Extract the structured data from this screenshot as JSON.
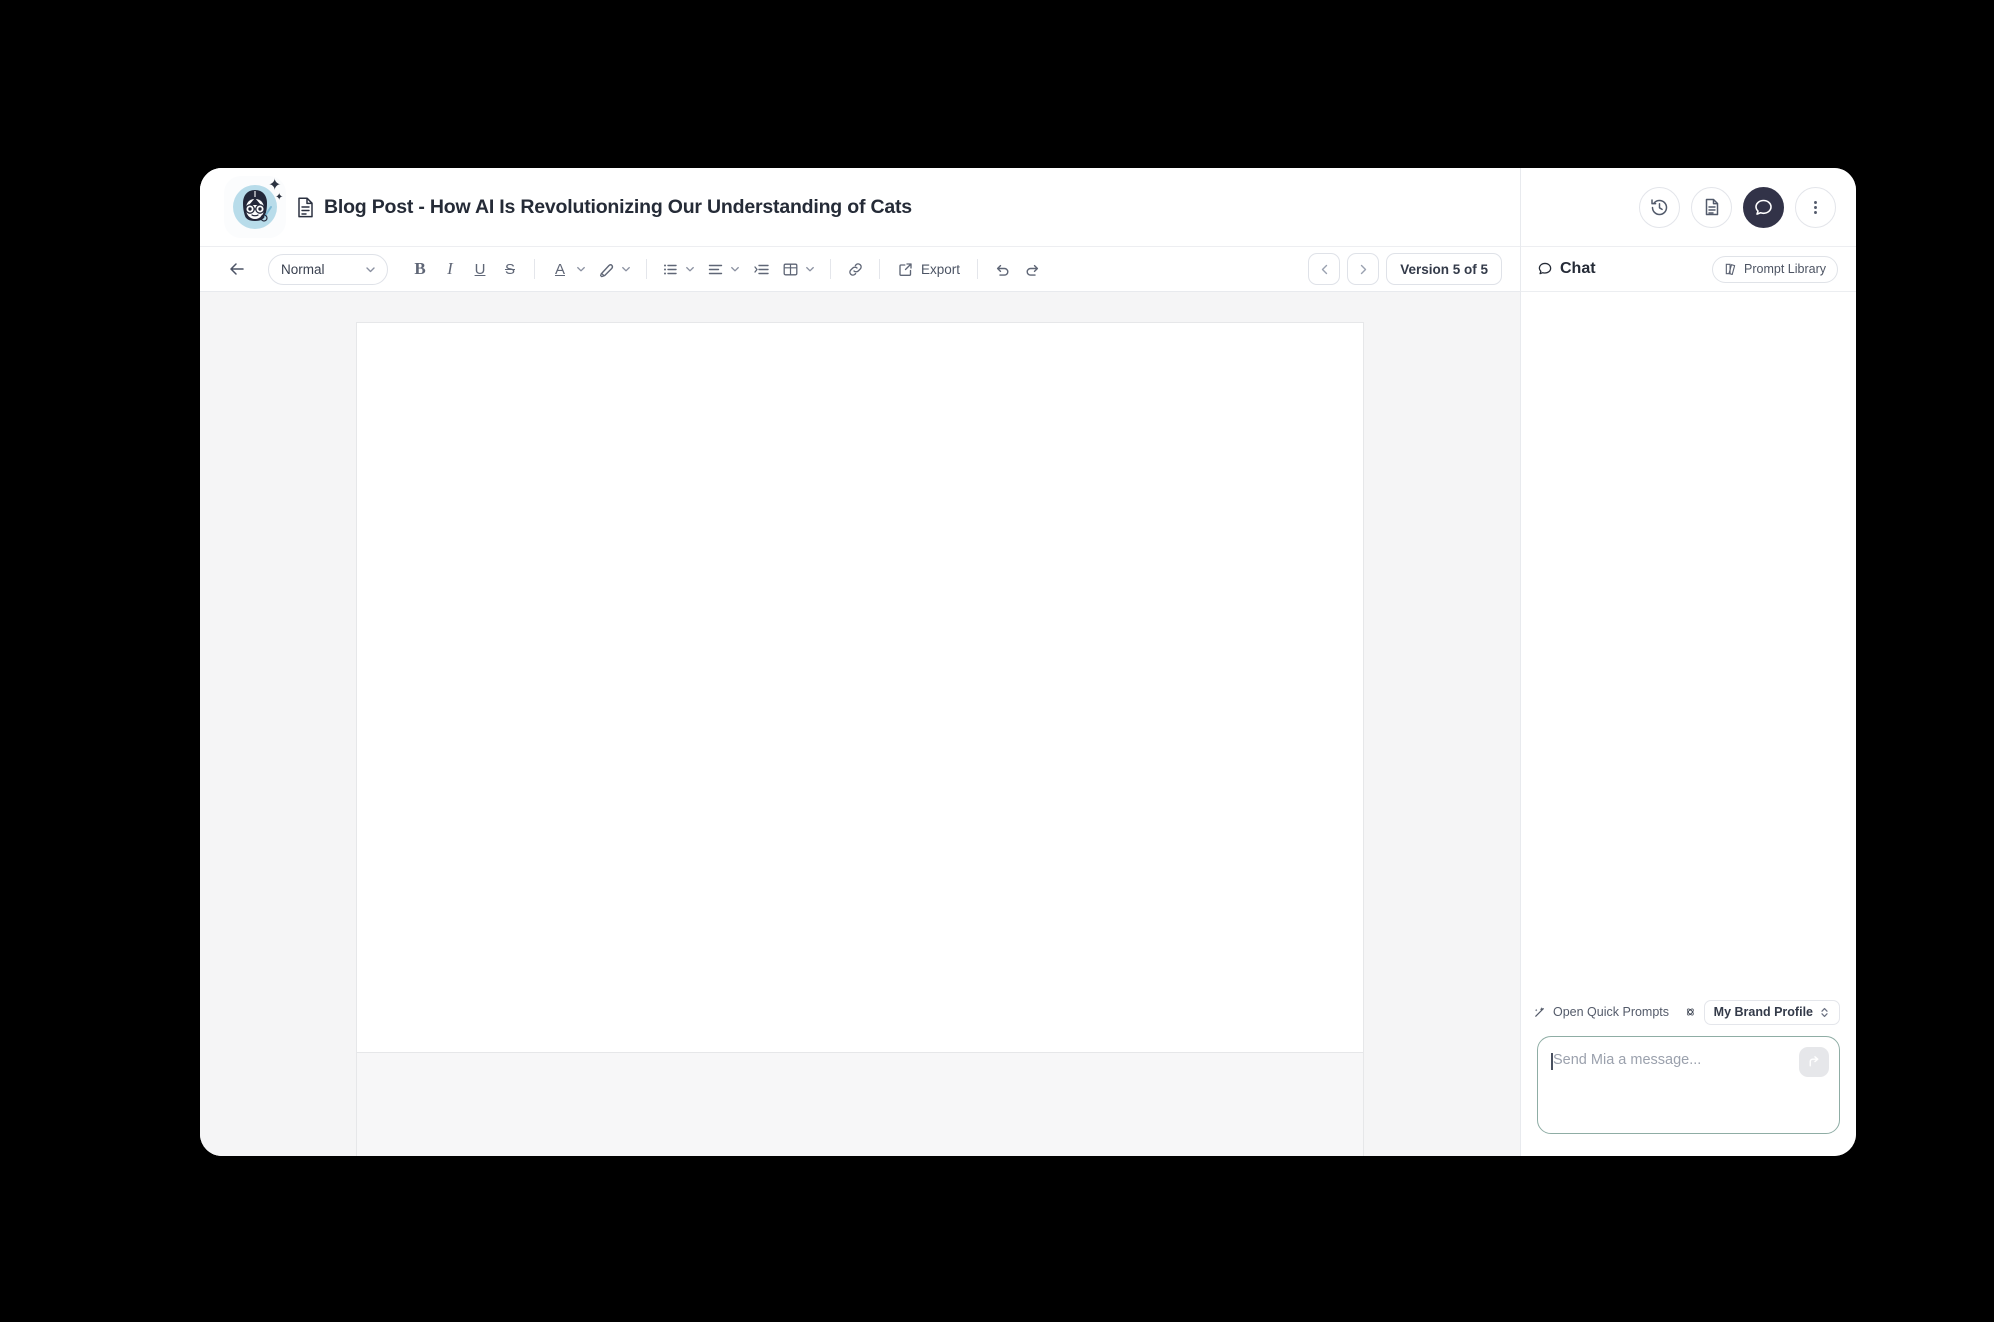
{
  "window": {
    "document": {
      "title": "Blog Post - How AI Is Revolutionizing Our Understanding of Cats",
      "file_icon": "document-icon",
      "avatar_icon": "mia-assistant-avatar"
    },
    "toolbar": {
      "back_icon": "arrow-left-icon",
      "paragraph_style": "Normal",
      "bold_label": "B",
      "italic_label": "I",
      "underline_label": "U",
      "strikethrough_label": "S",
      "text_color_label": "A",
      "highlight_icon": "highlighter-icon",
      "bullet_list_icon": "bullet-list-icon",
      "align_icon": "align-icon",
      "indent_icon": "indent-icon",
      "table_icon": "table-icon",
      "link_icon": "link-icon",
      "export_label": "Export",
      "export_icon": "external-link-icon",
      "undo_icon": "undo-icon",
      "redo_icon": "redo-icon",
      "prev_version_icon": "chevron-left-icon",
      "next_version_icon": "chevron-right-icon",
      "version_label": "Version 5 of 5"
    },
    "chat": {
      "header_buttons": [
        {
          "name": "history-button",
          "icon": "history-icon",
          "active": false
        },
        {
          "name": "document-button",
          "icon": "document-icon",
          "active": false
        },
        {
          "name": "chat-button",
          "icon": "chat-bubble-icon",
          "active": true
        },
        {
          "name": "more-options-button",
          "icon": "kebab-menu-icon",
          "active": false
        }
      ],
      "panel_title": "Chat",
      "panel_title_icon": "chat-bubble-icon",
      "prompt_library_label": "Prompt Library",
      "prompt_library_icon": "book-icon",
      "quick_prompts_label": "Open Quick Prompts",
      "quick_prompts_icon": "magic-wand-icon",
      "brand_profile_label": "My Brand Profile",
      "brand_profile_icon": "brand-icon",
      "brand_profile_chevron": "chevron-up-down-icon",
      "composer_placeholder": "Send Mia a message...",
      "send_icon": "send-arrow-icon"
    }
  },
  "colors": {
    "accent_dark": "#323348",
    "composer_focus": "#8fada5",
    "canvas_bg": "#f5f5f6",
    "avatar_ring": "#b8dcea",
    "page_border": "#e6e7e9"
  }
}
